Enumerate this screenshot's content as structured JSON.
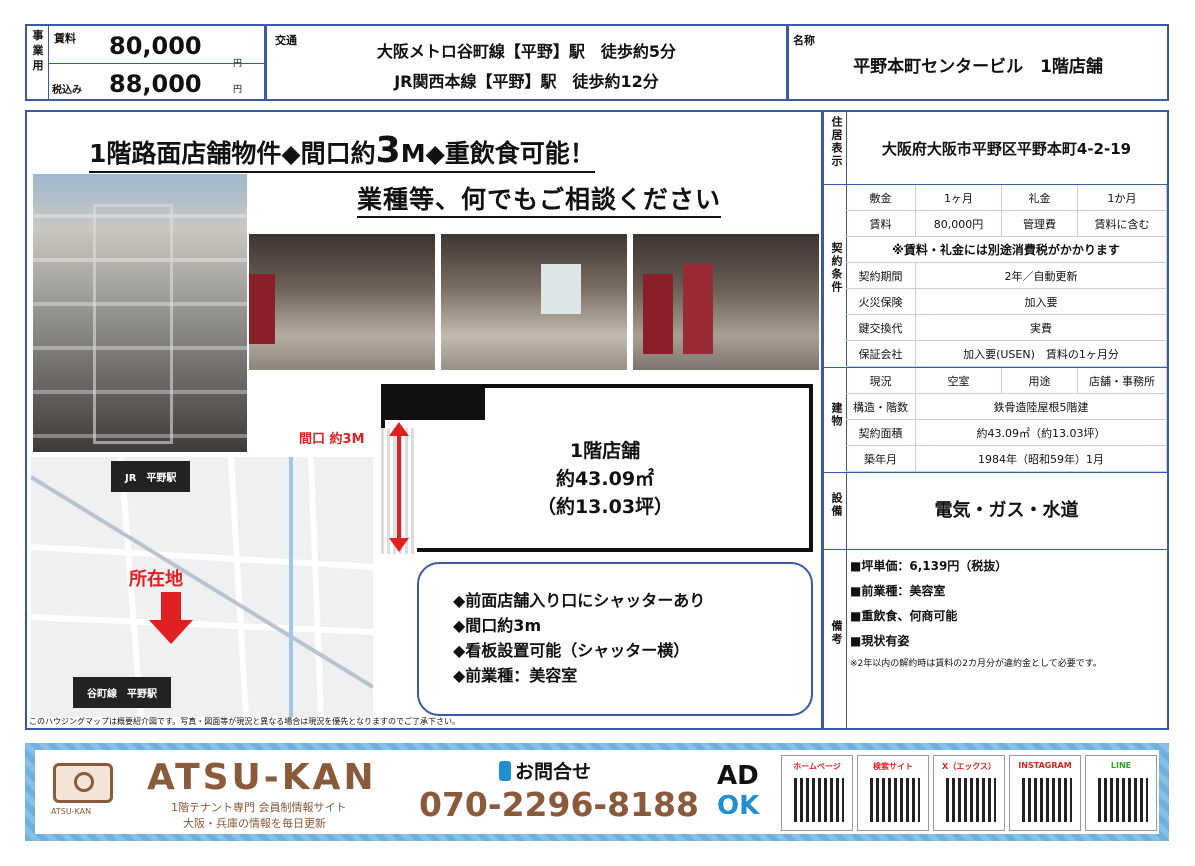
{
  "header": {
    "side_label": "事業用",
    "rent_label": "賃料",
    "rent": "80,000",
    "yen": "円",
    "tax_label": "税込み",
    "rent_tax": "88,000",
    "yen2": "円",
    "access_label": "交通",
    "access1": "大阪メトロ谷町線【平野】駅　徒歩約5分",
    "access2": "JR関西本線【平野】駅　徒歩約12分",
    "name_label": "名称",
    "name": "平野本町センタービル　1階店舗"
  },
  "left": {
    "headline1_a": "1階路面店舗物件◆間口約",
    "headline1_big": "3",
    "headline1_b": "M◆重飲食可能！",
    "headline2": "業種等、何でもご相談ください",
    "map_jr": "JR　平野駅",
    "map_location": "所在地",
    "map_subway": "谷町線　平野駅",
    "frontage": "間口 約3M",
    "floor1": "1階店舗",
    "floor2": "約43.09㎡",
    "floor3": "（約13.03坪）",
    "features": [
      "◆前面店舗入り口にシャッターあり",
      "◆間口約3m",
      "◆看板設置可能（シャッター横）",
      "◆前業種：美容室"
    ],
    "disclaimer": "このハウジングマップは概要紹介図です。写真・図面等が現況と異なる場合は現況を優先となりますのでご了承下さい。"
  },
  "right": {
    "address_label": "住居表示",
    "address": "大阪府大阪市平野区平野本町4-2-19",
    "contract_label": "契約条件",
    "deposit_label": "敷金",
    "deposit": "1ヶ月",
    "key_label": "礼金",
    "key": "1か月",
    "rent_label": "賃料",
    "rent": "80,000円",
    "mgmt_label": "管理費",
    "mgmt": "賃料に含む",
    "tax_note": "※賃料・礼金には別途消費税がかかります",
    "period_label": "契約期間",
    "period": "2年／自動更新",
    "fire_label": "火災保険",
    "fire": "加入要",
    "lock_label": "鍵交換代",
    "lock": "実費",
    "guar_label": "保証会社",
    "guar": "加入要(USEN)　賃料の1ヶ月分",
    "bldg_label": "建物",
    "status_label": "現況",
    "status": "空室",
    "use_label": "用途",
    "use": "店舗・事務所",
    "struct_label": "構造・階数",
    "struct": "鉄骨造陸屋根5階建",
    "area_label": "契約面積",
    "area": "約43.09㎡（約13.03坪）",
    "built_label": "築年月",
    "built": "1984年（昭和59年）1月",
    "equip_label": "設備",
    "equip": "電気・ガス・水道",
    "notes_label": "備考",
    "notes": [
      "■坪単価：6,139円（税抜）",
      "■前業種：美容室",
      "■重飲食、何商可能",
      "■現状有姿"
    ],
    "notes_small": "※2年以内の解約時は賃料の2カ月分が違約金として必要です。"
  },
  "footer": {
    "logo_text": "ATSU-KAN",
    "brand": "ATSU-KAN",
    "tag1": "1階テナント専門 会員制情報サイト",
    "tag2": "大阪・兵庫の情報を毎日更新",
    "contact": "お問合せ",
    "phone": "070-2296-8188",
    "ad1": "AD",
    "ad2": "OK",
    "qr": [
      "ホームページ",
      "検索サイト",
      "X（エックス）",
      "INSTAGRAM",
      "LINE"
    ]
  },
  "colors": {
    "border": "#3a5aa8",
    "red": "#e02020",
    "blue": "#1f8fd0",
    "footer_bg": "#6fb0de"
  }
}
